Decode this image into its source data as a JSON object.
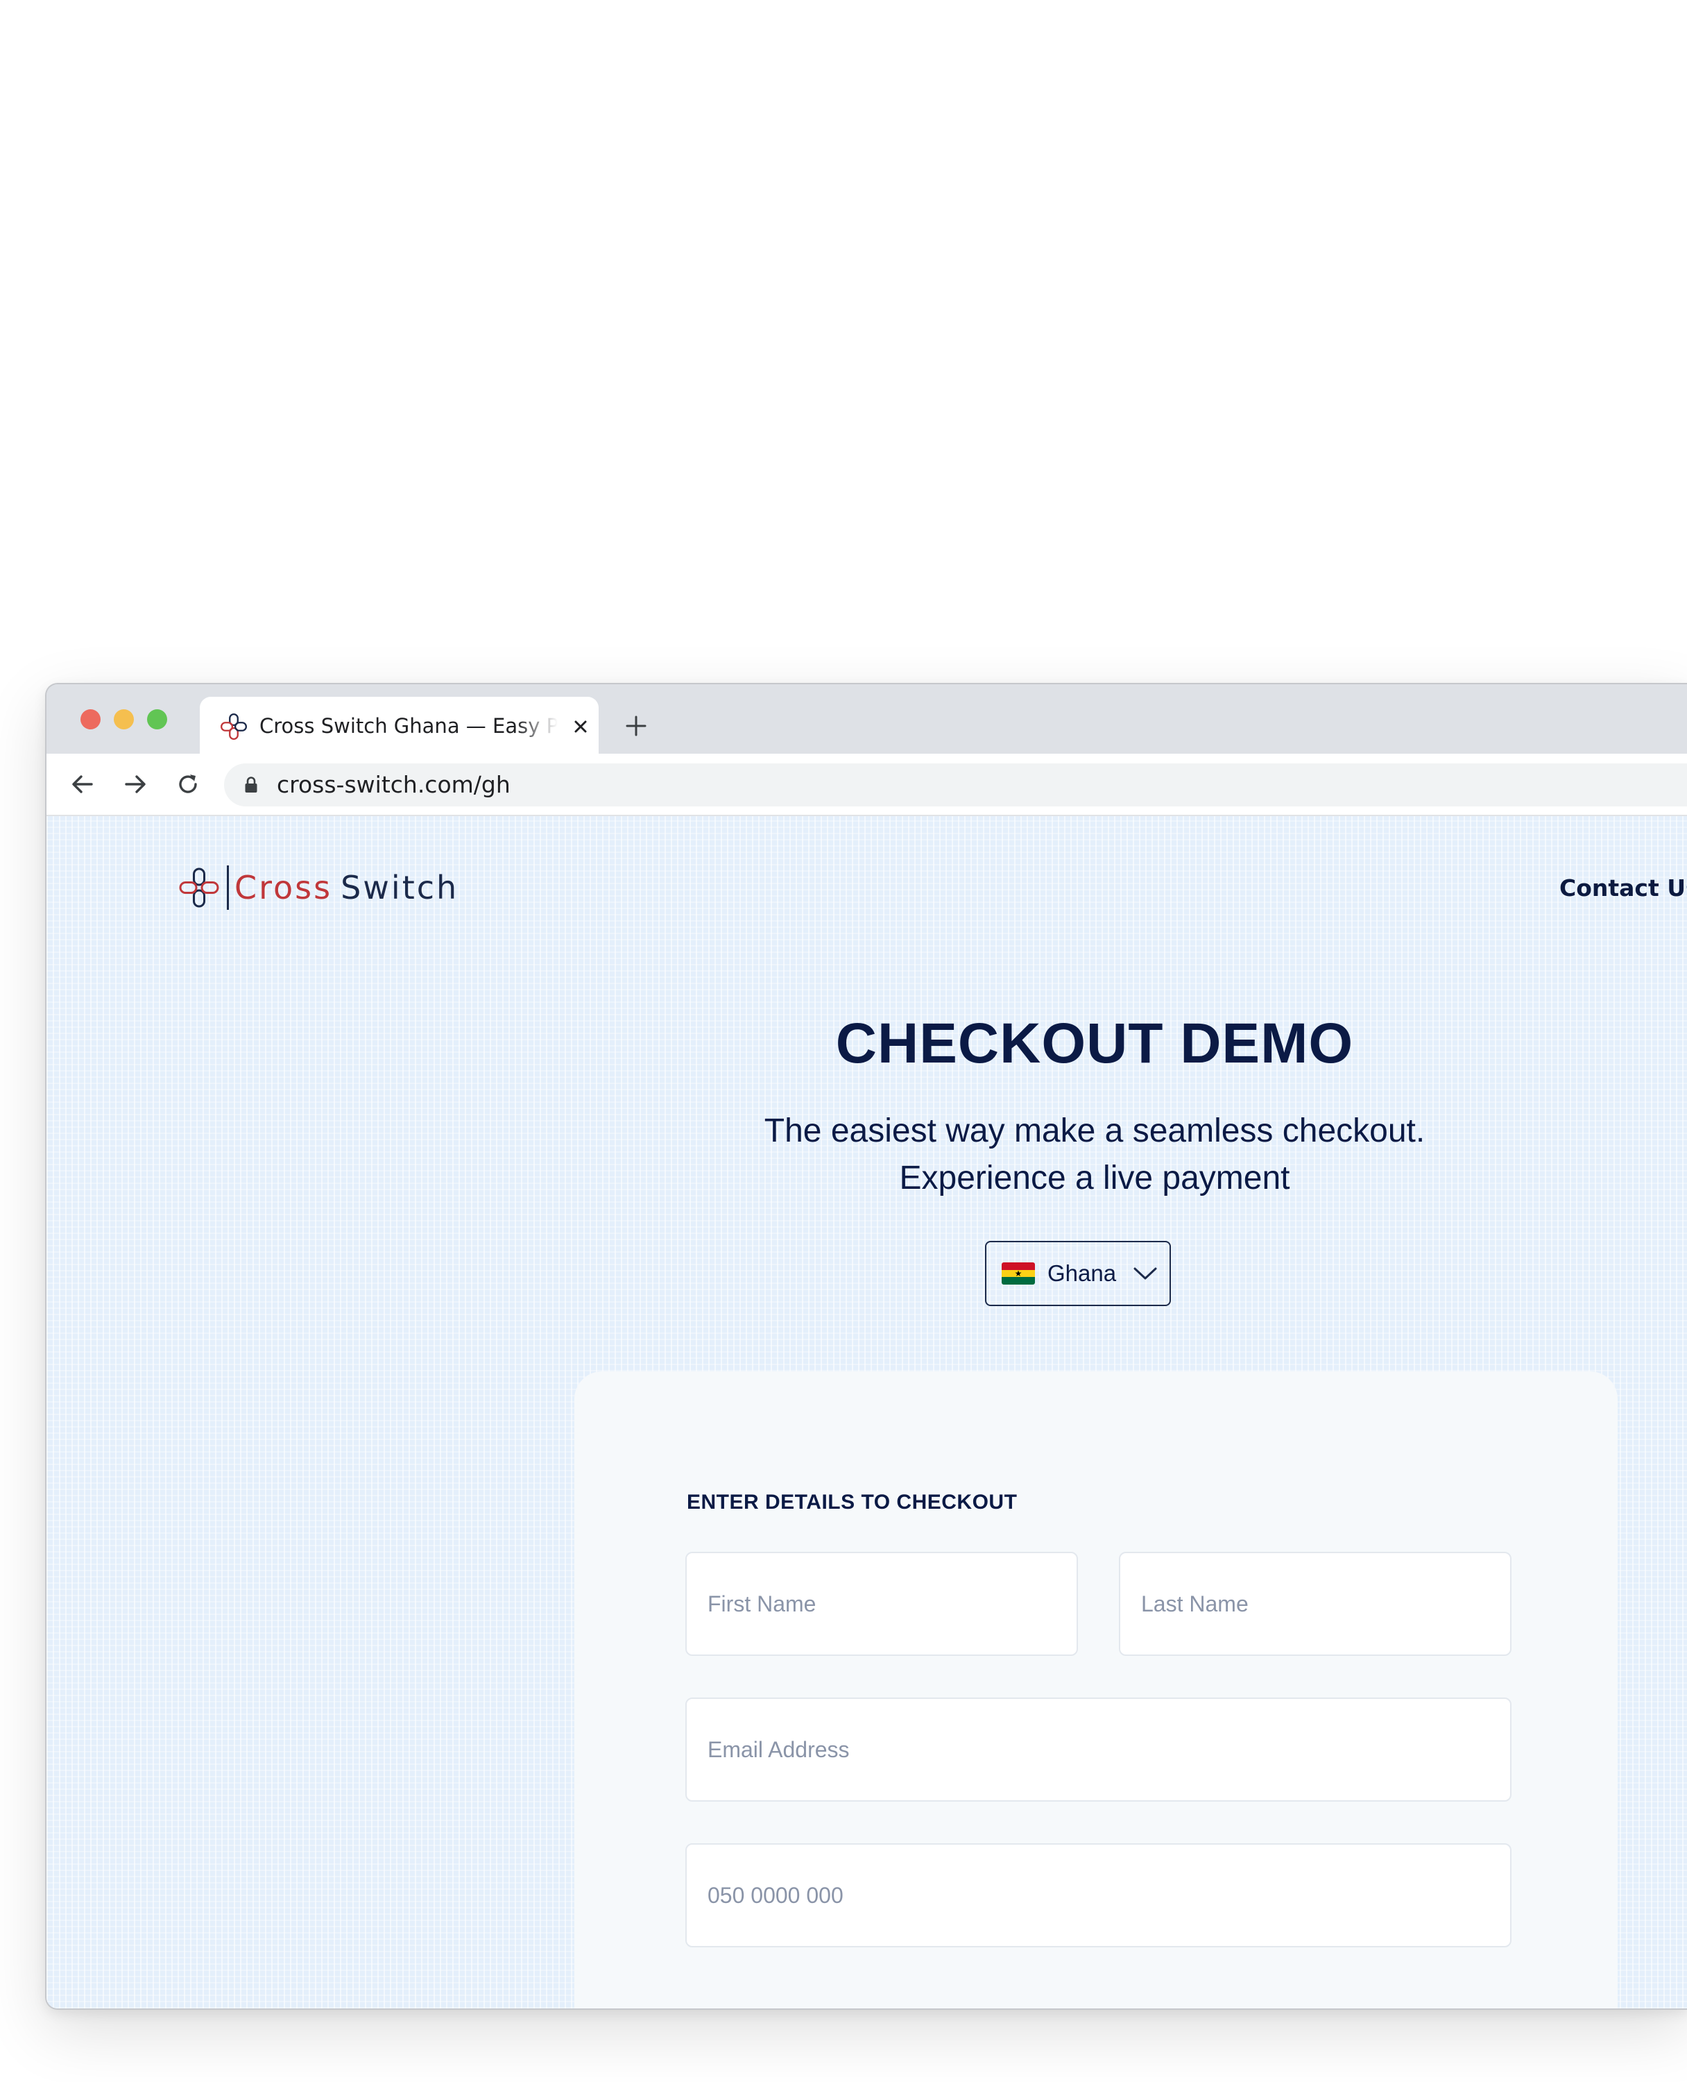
{
  "browser": {
    "tab_title": "Cross Switch Ghana — Easy Payments",
    "url": "cross-switch.com/gh"
  },
  "header": {
    "brand_first": "Cross",
    "brand_second": "Switch",
    "contact_link": "Contact Us"
  },
  "hero": {
    "title": "CHECKOUT DEMO",
    "subtitle_line1": "The easiest way make a seamless checkout.",
    "subtitle_line2": "Experience a live payment"
  },
  "country_select": {
    "selected": "Ghana",
    "flag": "ghana-flag-icon"
  },
  "form": {
    "heading": "ENTER DETAILS TO CHECKOUT",
    "first_name_placeholder": "First Name",
    "last_name_placeholder": "Last Name",
    "email_placeholder": "Email Address",
    "phone_placeholder": "050 0000 000"
  },
  "colors": {
    "brand_red": "#c0373a",
    "brand_navy": "#1c2a4a",
    "heading_navy": "#0b1a45",
    "page_background": "#e4effb"
  }
}
